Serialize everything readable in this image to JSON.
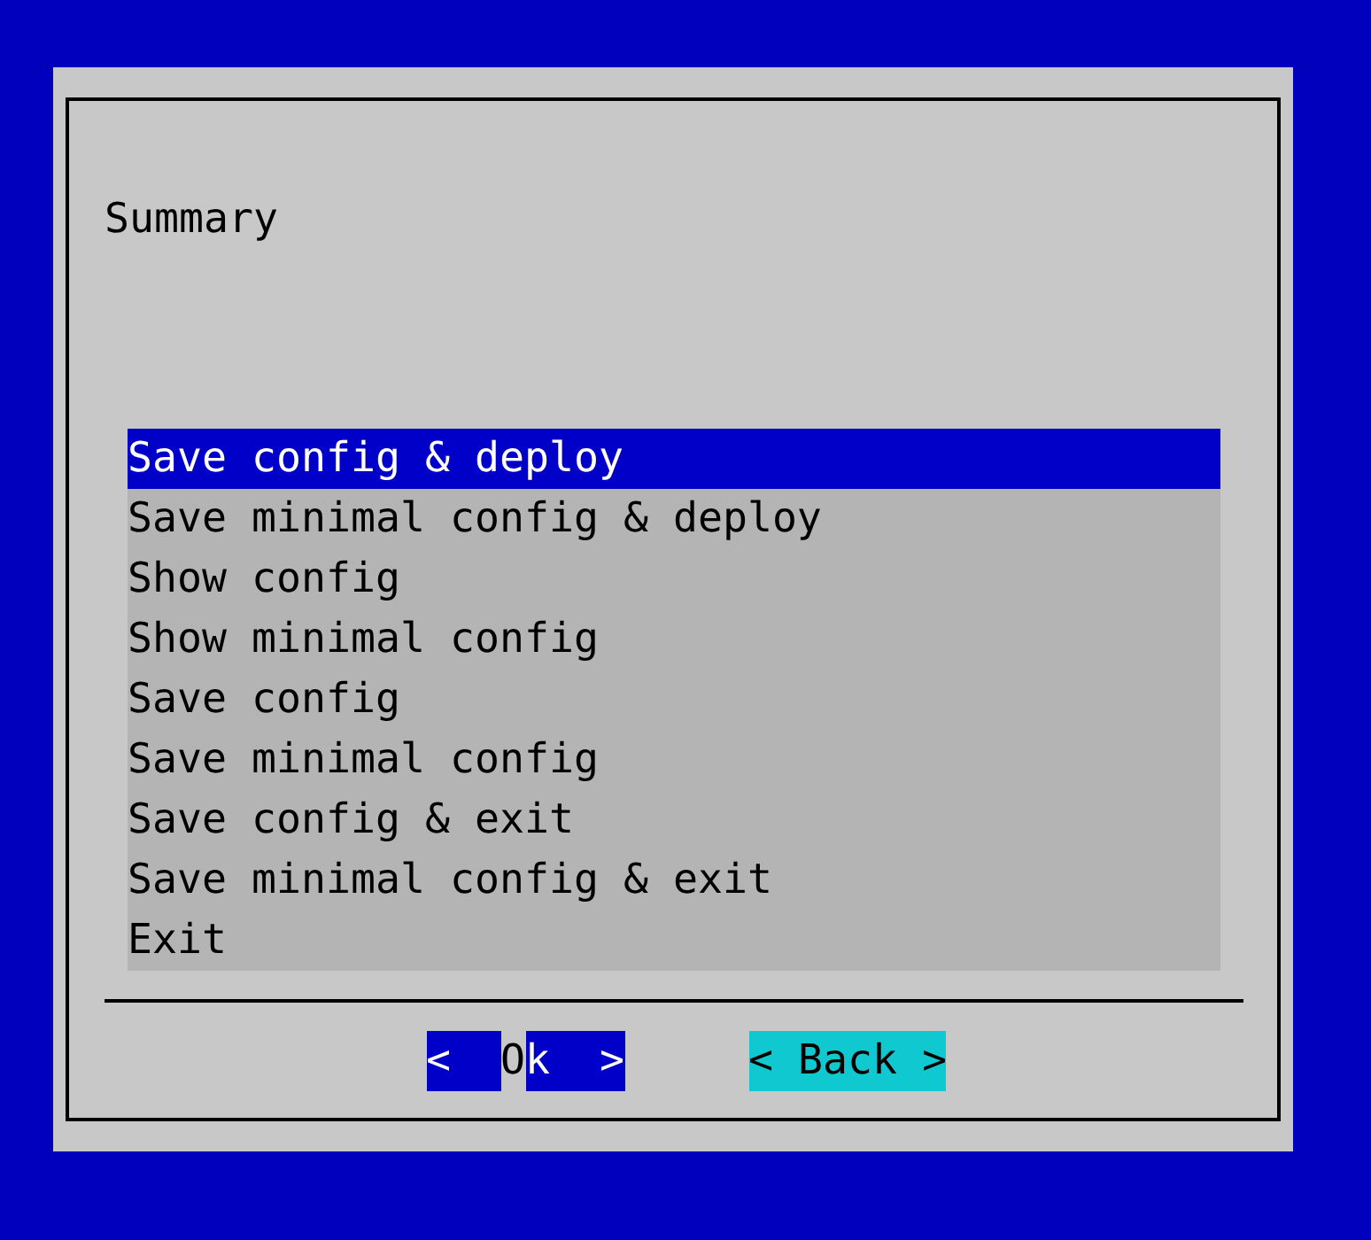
{
  "dialog": {
    "prompt": "Summary"
  },
  "menu": {
    "items": [
      {
        "label": "Save config & deploy",
        "selected": true
      },
      {
        "label": "Save minimal config & deploy",
        "selected": false
      },
      {
        "label": "Show config",
        "selected": false
      },
      {
        "label": "Show minimal config",
        "selected": false
      },
      {
        "label": "Save config",
        "selected": false
      },
      {
        "label": "Save minimal config",
        "selected": false
      },
      {
        "label": "Save config & exit",
        "selected": false
      },
      {
        "label": "Save minimal config & exit",
        "selected": false
      },
      {
        "label": "Exit",
        "selected": false
      }
    ]
  },
  "buttons": [
    {
      "selected": true,
      "parts": [
        {
          "text": "<  ",
          "cursor": false
        },
        {
          "text": "O",
          "cursor": true
        },
        {
          "text": "k  >",
          "cursor": false
        }
      ]
    },
    {
      "selected": false,
      "parts": [
        {
          "text": "< Back >",
          "cursor": false
        }
      ]
    }
  ]
}
